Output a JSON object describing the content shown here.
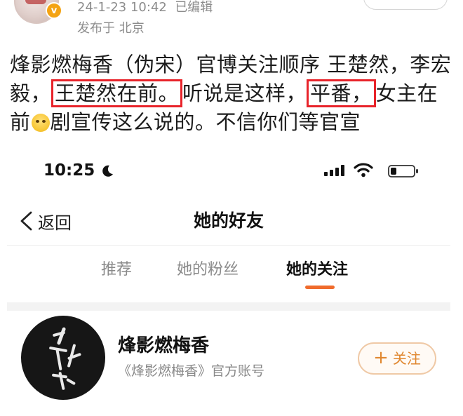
{
  "post": {
    "timestamp": "24-1-23 10:42",
    "edited": "已编辑",
    "location": "发布于 北京",
    "verified_badge": "v",
    "body": {
      "seg1": "烽影燃梅香（伪宋）官博关注顺序 王楚然，李宏毅，",
      "highlight1": "王楚然在前。",
      "seg2": "听说是这样，",
      "highlight2": "平番，",
      "seg3": "女主在前",
      "emoji": "laughing-crying-emoji",
      "seg4": "剧宣传这么说的。不信你们等官宣"
    },
    "highlight_color": "#e8232a"
  },
  "screenshot": {
    "status_bar": {
      "time": "10:25"
    },
    "nav": {
      "back_label": "返回",
      "title": "她的好友"
    },
    "tabs": [
      {
        "label": "推荐",
        "active": false
      },
      {
        "label": "她的粉丝",
        "active": false
      },
      {
        "label": "她的关注",
        "active": true
      }
    ],
    "accent_color": "#f06b2c",
    "account": {
      "name": "烽影燃梅香",
      "description": "《烽影燃梅香》官方账号",
      "follow_label": "关注",
      "follow_icon": "plus-icon"
    }
  }
}
